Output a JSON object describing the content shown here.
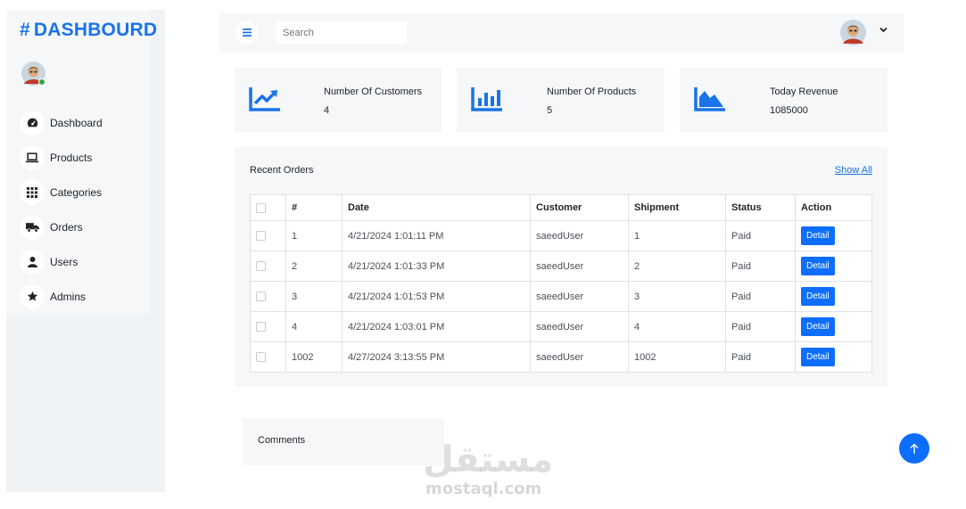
{
  "brand": {
    "hash": "#",
    "name": "DASHBOURD",
    "color": "#1a73e8"
  },
  "sidebar": {
    "items": [
      {
        "label": "Dashboard",
        "icon": "gauge-icon"
      },
      {
        "label": "Products",
        "icon": "laptop-icon"
      },
      {
        "label": "Categories",
        "icon": "grid-icon"
      },
      {
        "label": "Orders",
        "icon": "truck-icon"
      },
      {
        "label": "Users",
        "icon": "user-icon"
      },
      {
        "label": "Admins",
        "icon": "star-icon"
      }
    ]
  },
  "topbar": {
    "search_placeholder": "Search",
    "menu_icon": "hamburger-icon",
    "avatar_icon": "avatar-icon",
    "dropdown_icon": "chevron-down-icon"
  },
  "stats": [
    {
      "title": "Number Of Customers",
      "value": "4",
      "icon": "trend-chart-icon"
    },
    {
      "title": "Number Of Products",
      "value": "5",
      "icon": "bar-chart-icon"
    },
    {
      "title": "Today Revenue",
      "value": "1085000",
      "icon": "area-chart-icon"
    }
  ],
  "orders": {
    "title": "Recent Orders",
    "show_all": "Show All",
    "columns": [
      "#",
      "Date",
      "Customer",
      "Shipment",
      "Status",
      "Action"
    ],
    "rows": [
      {
        "id": "1",
        "date": "4/21/2024 1:01:11 PM",
        "customer": "saeedUser",
        "shipment": "1",
        "status": "Paid",
        "action": "Detail"
      },
      {
        "id": "2",
        "date": "4/21/2024 1:01:33 PM",
        "customer": "saeedUser",
        "shipment": "2",
        "status": "Paid",
        "action": "Detail"
      },
      {
        "id": "3",
        "date": "4/21/2024 1:01:53 PM",
        "customer": "saeedUser",
        "shipment": "3",
        "status": "Paid",
        "action": "Detail"
      },
      {
        "id": "4",
        "date": "4/21/2024 1:03:01 PM",
        "customer": "saeedUser",
        "shipment": "4",
        "status": "Paid",
        "action": "Detail"
      },
      {
        "id": "1002",
        "date": "4/27/2024 3:13:55 PM",
        "customer": "saeedUser",
        "shipment": "1002",
        "status": "Paid",
        "action": "Detail"
      }
    ]
  },
  "comments": {
    "title": "Comments"
  },
  "watermark": {
    "arabic": "مستقل",
    "latin": "mostaql.com"
  },
  "colors": {
    "accent": "#0d6efd",
    "panel": "#f5f7f9",
    "online": "#28a745"
  }
}
